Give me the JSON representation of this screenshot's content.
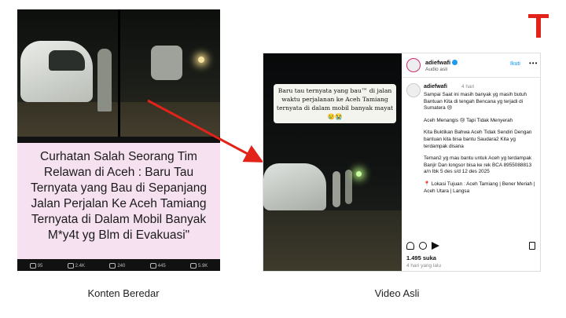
{
  "brand": {
    "logo_letter": "T",
    "color": "#e2231a"
  },
  "left_panel": {
    "caption": "Curhatan Salah Seorang Tim Relawan di Aceh : Baru Tau Ternyata yang Bau di Sepanjang Jalan Perjalan Ke Aceh Tamiang Ternyata di Dalam Mobil Banyak M*y4t yg Blm di Evakuasi\"",
    "caption_bg": "#f6e1f1",
    "toolbar": [
      "95",
      "2.4K",
      "240",
      "445",
      "5.9K"
    ],
    "label": "Konten Beredar"
  },
  "right_panel": {
    "video_caption": "Baru tau ternyata yang bau™ di jalan waktu perjalanan ke Aceh Tamiang ternyata di dalam mobil banyak mayat 😢😭",
    "header": {
      "username": "adiefwafi",
      "subtitle": "Audio asli",
      "follow": "Ikuti",
      "more": "•••"
    },
    "comment": {
      "username": "adiefwafi",
      "time": "4 hari",
      "paragraphs": [
        "Sampai Saat ini masih banyak yg masih butuh Bantuan Kita di tengah Bencana yg terjadi di Sumatera 😢",
        "Aceh Menangis 😢 Tapi Tidak Menyerah",
        "Kita Buktikan Bahwa Aceh Tidak Sendiri Dengan bantuan kita bisa bantu Saudara2 Kita yg terdampak disana",
        "Teman2 yg mau bantu untuk Aceh yg terdampak Banjir Dan longsor bisa ke rek BCA 8955088813 a/n Ibk 5 des s/d 12 des 2025",
        "📍 Lokasi Tujuan : Aceh Tamiang | Bener Meriah | Aceh Utara | Langsa"
      ]
    },
    "likes": "1.495 suka",
    "date": "4 hari yang lalu",
    "label": "Video Asli"
  },
  "arrow_color": "#e2231a"
}
